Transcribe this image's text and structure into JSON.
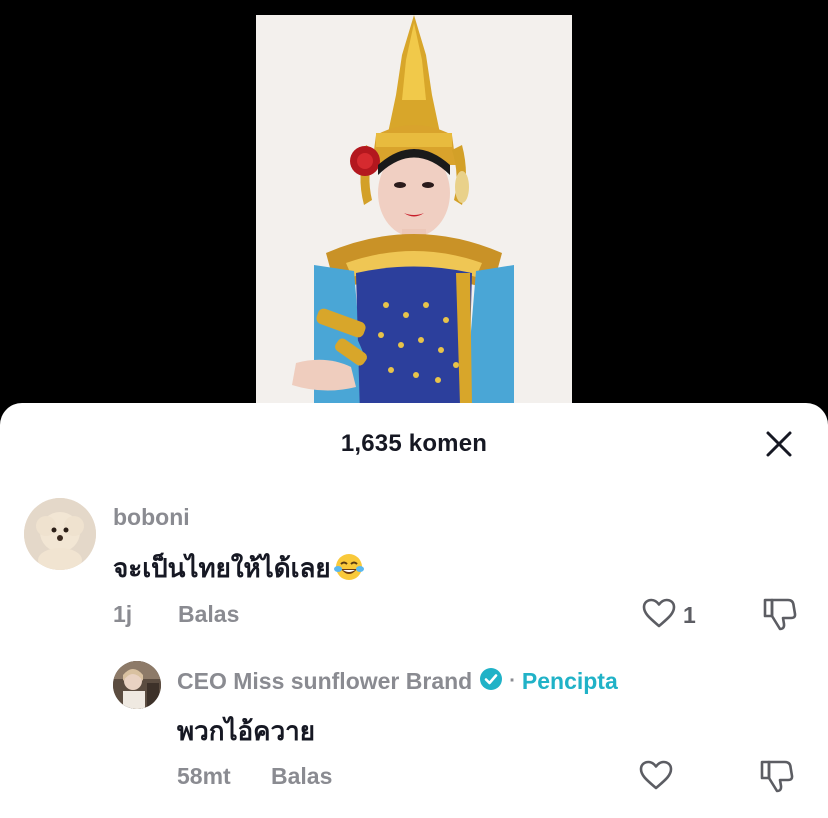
{
  "header": {
    "comment_count_label": "1,635 komen"
  },
  "comments": [
    {
      "username": "boboni",
      "text": "จะเป็นไทยให้ได้เลย",
      "emoji": "tears-of-joy-emoji",
      "time": "1j",
      "reply_label": "Balas",
      "likes": "1"
    }
  ],
  "replies": [
    {
      "username": "CEO Miss sunflower Brand",
      "separator": "·",
      "creator_badge": "Pencipta",
      "text": "พวกไอ้ควาย",
      "time": "58mt",
      "reply_label": "Balas"
    }
  ],
  "icons": {
    "close": "close-icon",
    "like": "heart-outline-icon",
    "dislike": "thumbs-down-icon",
    "verified": "verified-badge-icon"
  },
  "colors": {
    "sheet_bg": "#ffffff",
    "text_primary": "#161823",
    "text_secondary": "#8a8b91",
    "creator_accent": "#20b2c7",
    "verified_badge": "#20b2c7"
  }
}
